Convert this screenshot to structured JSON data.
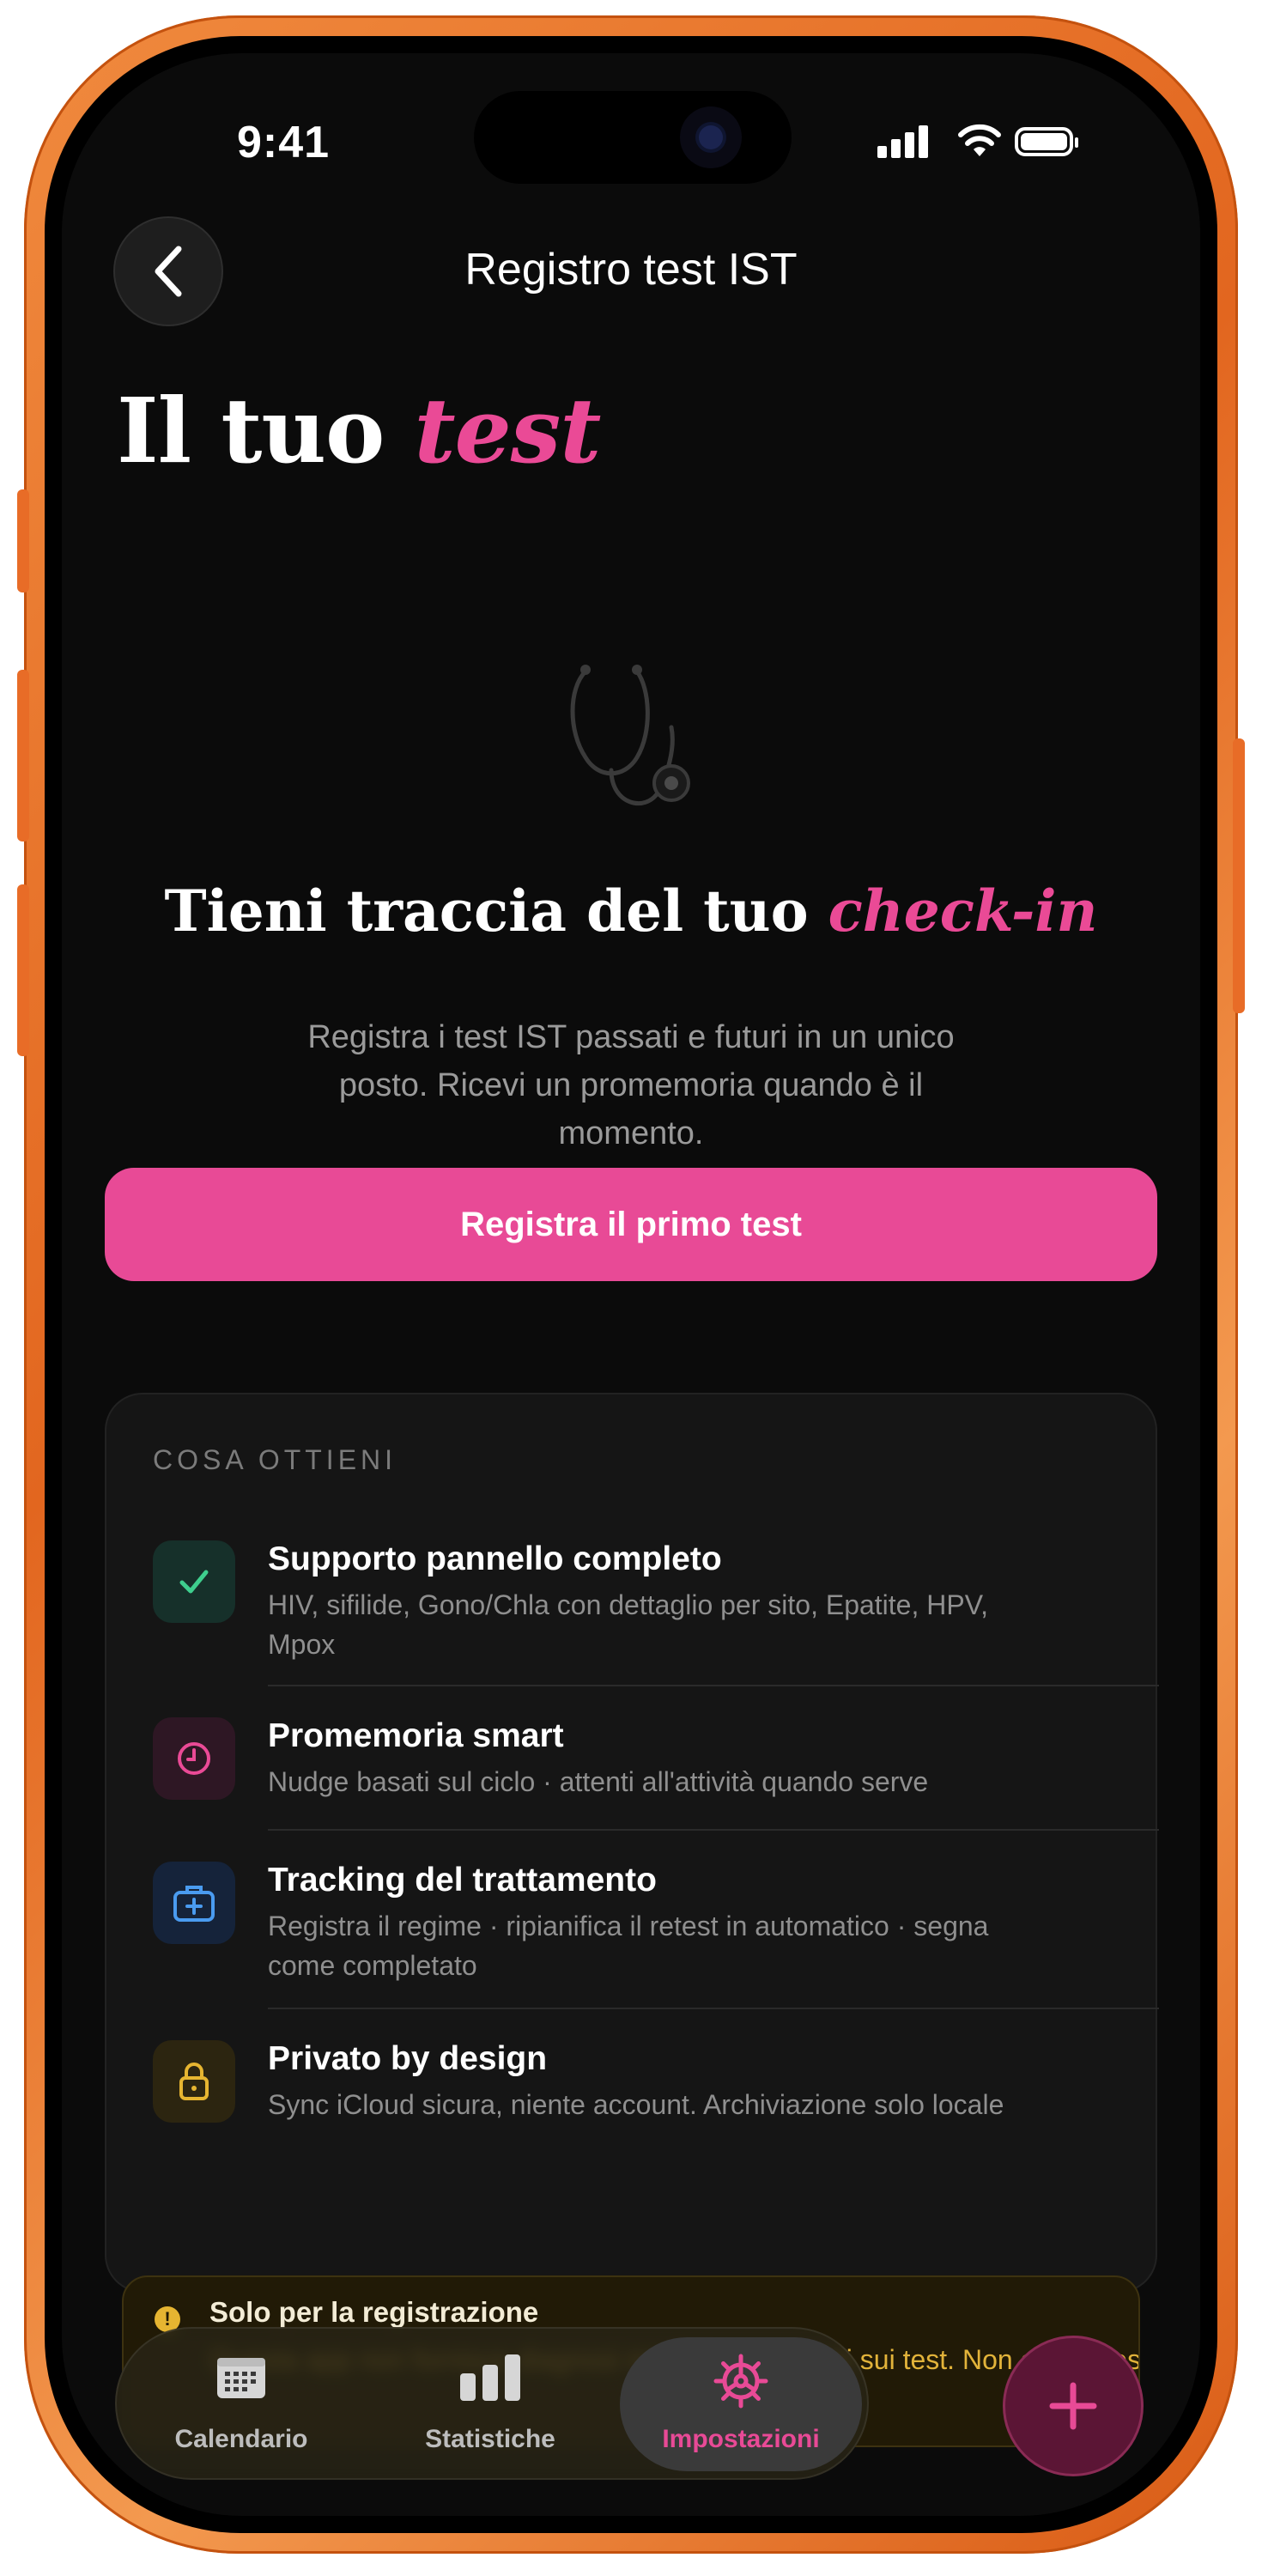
{
  "status_bar": {
    "time": "9:41"
  },
  "header": {
    "title": "Registro test IST",
    "back_icon": "chevron-left-icon"
  },
  "page": {
    "title_prefix": "Il tuo ",
    "title_accent": "test"
  },
  "hero": {
    "icon": "stethoscope-icon",
    "title_prefix": "Tieni traccia del tuo ",
    "title_accent": "check-in",
    "description": "Registra i test IST passati e futuri in un unico posto. Ricevi un promemoria quando è il momento.",
    "cta_label": "Registra il primo test"
  },
  "benefits": {
    "label": "COSA OTTIENI",
    "items": [
      {
        "icon": "check-icon",
        "color": "#3ecf8e",
        "bg": "#16302a",
        "title": "Supporto pannello completo",
        "description": "HIV, sifilide, Gono/Chla con dettaglio per sito, Epatite, HPV, Mpox"
      },
      {
        "icon": "clock-icon",
        "color": "#ea4a96",
        "bg": "#2e1724",
        "title": "Promemoria smart",
        "description": "Nudge basati sul ciclo · attenti all'attività quando serve"
      },
      {
        "icon": "medical-kit-icon",
        "color": "#4a9bf0",
        "bg": "#15233a",
        "title": "Tracking del trattamento",
        "description": "Registra il regime · ripianifica il retest in automatico · segna come completato"
      },
      {
        "icon": "lock-icon",
        "color": "#e6b531",
        "bg": "#2c2510",
        "title": "Privato by design",
        "description": "Sync iCloud sicura, niente account. Archiviazione solo locale"
      }
    ]
  },
  "notice": {
    "title": "Solo per la registrazione",
    "text": "Questa app non fornisce diagnosi mediche o consigli sui test. Non ordina test."
  },
  "tabbar": {
    "tabs": [
      {
        "label": "Calendario",
        "icon": "calendar-icon"
      },
      {
        "label": "Statistiche",
        "icon": "bar-chart-icon"
      },
      {
        "label": "Impostazioni",
        "icon": "gear-icon",
        "active": true
      }
    ],
    "accent": "#e84a96"
  },
  "fab": {
    "icon": "plus-icon"
  }
}
